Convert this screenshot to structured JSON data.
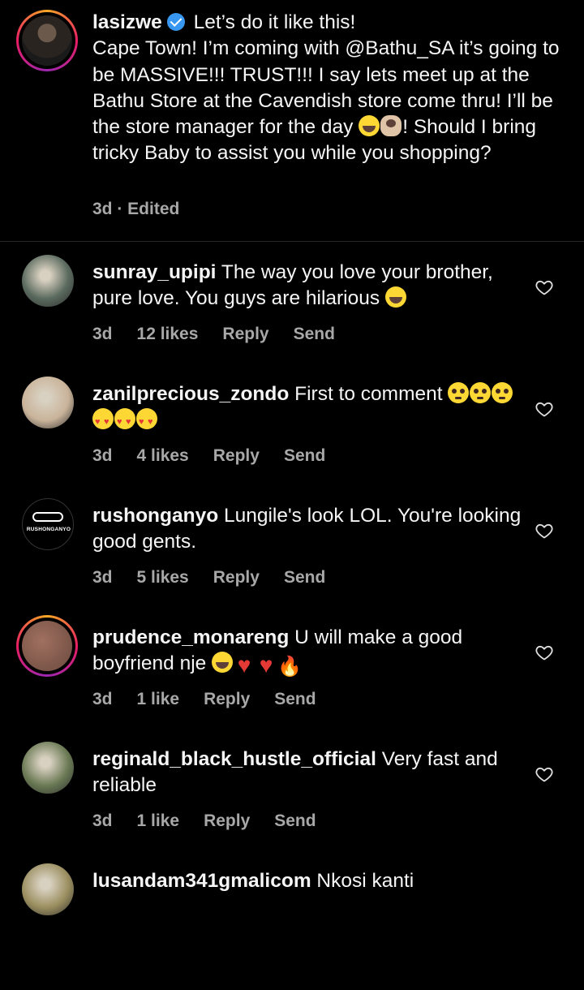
{
  "caption": {
    "username": "lasizwe",
    "text_line1": "Let’s do it like this!",
    "text_rest_a": "Cape Town! I’m coming with ",
    "mention": "@Bathu_SA",
    "text_rest_b": " it’s going to be MASSIVE!!! TRUST!!! I say lets meet up at the Bathu Store at the Cavendish store come thru! I’ll be the store manager for the day ",
    "text_rest_c": "! Should I bring tricky Baby to assist you while you shopping?",
    "emojis": [
      "grinning-sweat-icon",
      "shrug-icon"
    ],
    "meta": "3d · Edited"
  },
  "comments": [
    {
      "username": "sunray_upipi",
      "text": "The way you love your brother, pure love. You guys are hilarious",
      "emojis": [
        "laughing-icon"
      ],
      "time": "3d",
      "likes": "12 likes",
      "reply": "Reply",
      "send": "Send",
      "avatar_color": "#5a6a5e",
      "ring": false
    },
    {
      "username": "zanilprecious_zondo",
      "text": "First to comment",
      "emojis": [
        "pleading-icon",
        "pleading-icon",
        "pleading-icon",
        "heart-eyes-icon",
        "heart-eyes-icon",
        "heart-eyes-icon"
      ],
      "time": "3d",
      "likes": "4 likes",
      "reply": "Reply",
      "send": "Send",
      "avatar_color": "#c9b39a",
      "ring": false
    },
    {
      "username": "rushonganyo",
      "text": "Lungile's look LOL. You're looking good gents.",
      "emojis": [],
      "time": "3d",
      "likes": "5 likes",
      "reply": "Reply",
      "send": "Send",
      "avatar_logo": "RUSHONGANYO",
      "avatar_color": "#000000",
      "ring": false
    },
    {
      "username": "prudence_monareng",
      "text": "U will make a good boyfriend nje",
      "emojis": [
        "laughing-icon",
        "red-heart-icon",
        "red-heart-icon",
        "fire-icon"
      ],
      "time": "3d",
      "likes": "1 like",
      "reply": "Reply",
      "send": "Send",
      "avatar_color": "#7a5548",
      "ring": true
    },
    {
      "username": "reginald_black_hustle_official",
      "text": "Very fast and reliable",
      "emojis": [],
      "time": "3d",
      "likes": "1 like",
      "reply": "Reply",
      "send": "Send",
      "avatar_color": "#6b7a55",
      "ring": false
    },
    {
      "username": "lusandam341gmalicom",
      "text": "Nkosi kanti",
      "emojis": [],
      "time": "",
      "likes": "",
      "reply": "",
      "send": "",
      "avatar_color": "#9b8f60",
      "ring": false
    }
  ]
}
